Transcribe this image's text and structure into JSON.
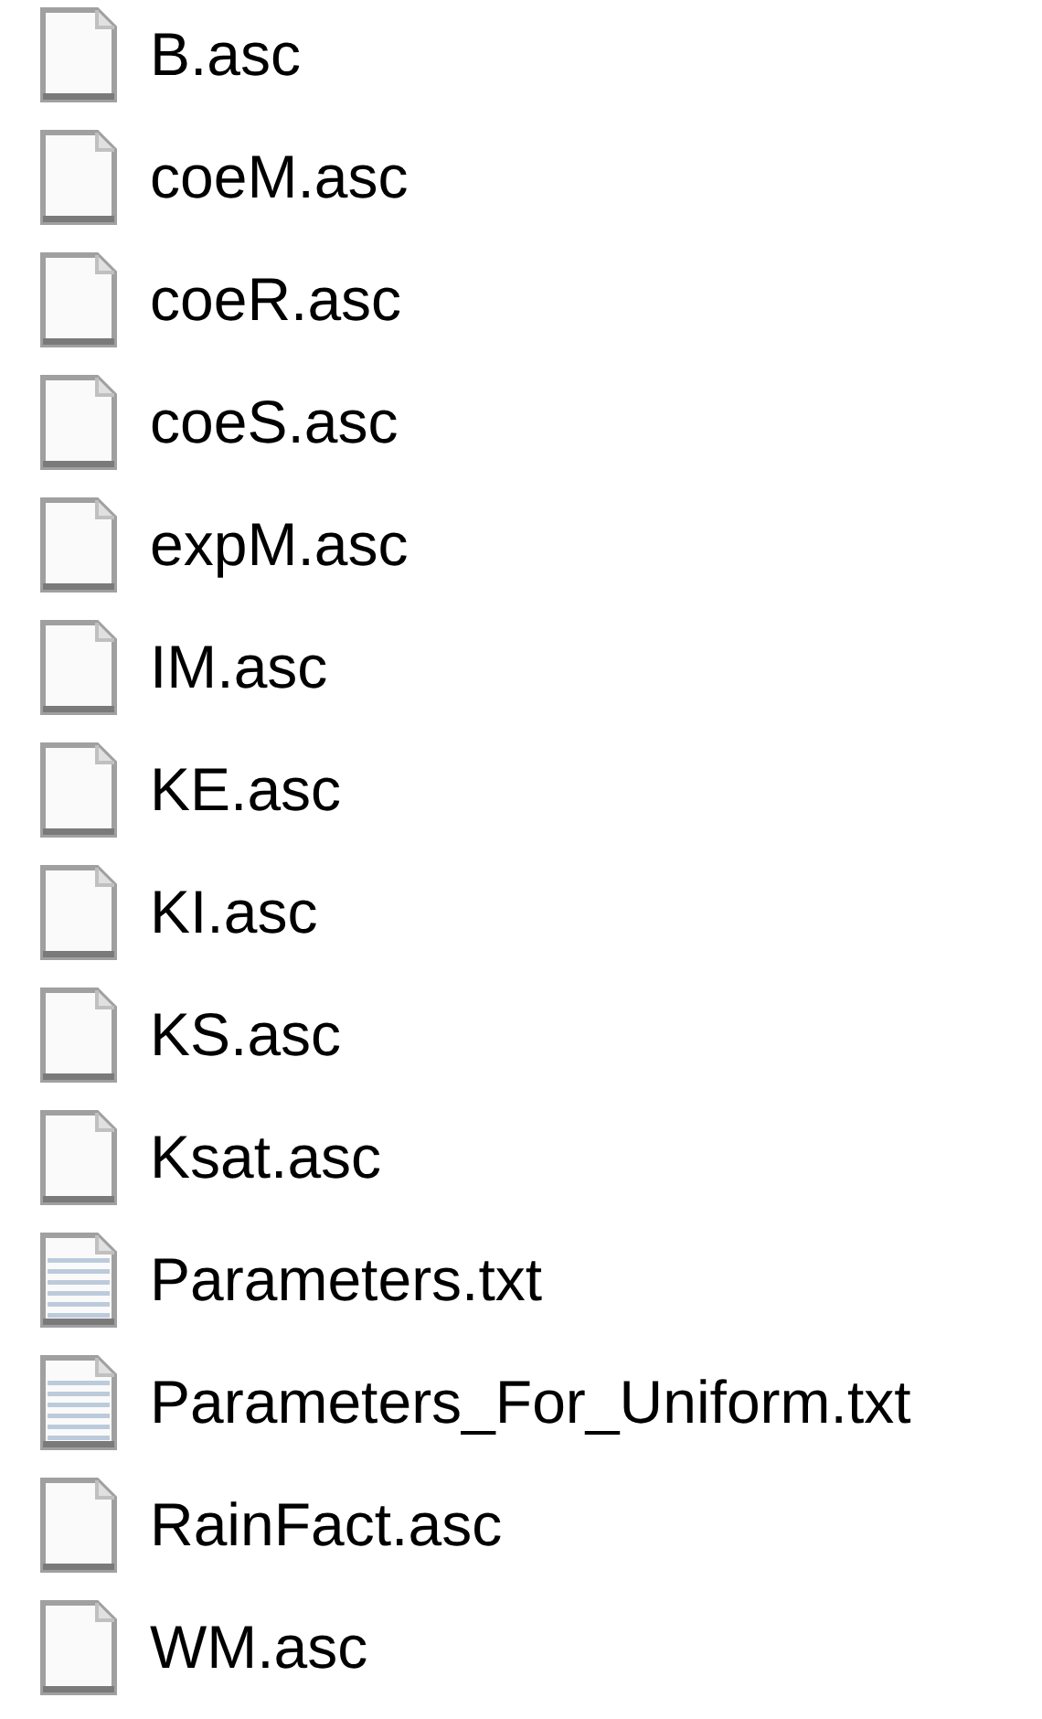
{
  "files": [
    {
      "name": "B.asc",
      "kind": "file"
    },
    {
      "name": "coeM.asc",
      "kind": "file"
    },
    {
      "name": "coeR.asc",
      "kind": "file"
    },
    {
      "name": "coeS.asc",
      "kind": "file"
    },
    {
      "name": "expM.asc",
      "kind": "file"
    },
    {
      "name": "IM.asc",
      "kind": "file"
    },
    {
      "name": "KE.asc",
      "kind": "file"
    },
    {
      "name": "KI.asc",
      "kind": "file"
    },
    {
      "name": "KS.asc",
      "kind": "file"
    },
    {
      "name": "Ksat.asc",
      "kind": "file"
    },
    {
      "name": "Parameters.txt",
      "kind": "text"
    },
    {
      "name": "Parameters_For_Uniform.txt",
      "kind": "text"
    },
    {
      "name": "RainFact.asc",
      "kind": "file"
    },
    {
      "name": "WM.asc",
      "kind": "file"
    }
  ]
}
